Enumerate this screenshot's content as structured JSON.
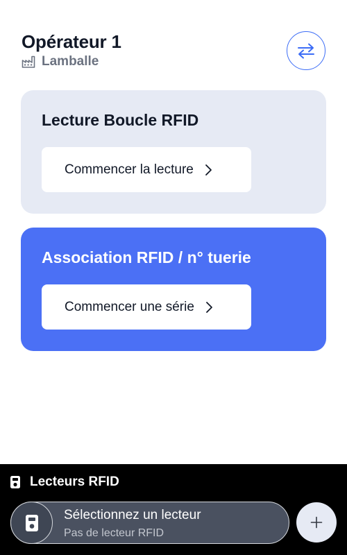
{
  "header": {
    "operator_title": "Opérateur 1",
    "site_name": "Lamballe",
    "site_icon": "factory-icon",
    "swap_icon": "swap-arrows-icon"
  },
  "cards": {
    "read_loop": {
      "title": "Lecture Boucle RFID",
      "button_label": "Commencer la lecture"
    },
    "association": {
      "title": "Association RFID / n° tuerie",
      "button_label": "Commencer une série"
    }
  },
  "readers": {
    "section_title": "Lecteurs RFID",
    "select_title": "Sélectionnez un lecteur",
    "select_subtitle": "Pas de lecteur RFID",
    "add_icon": "plus-icon"
  },
  "colors": {
    "accent": "#4b70f5",
    "card_light": "#e6eaf4",
    "bottom_bar": "#000000"
  }
}
